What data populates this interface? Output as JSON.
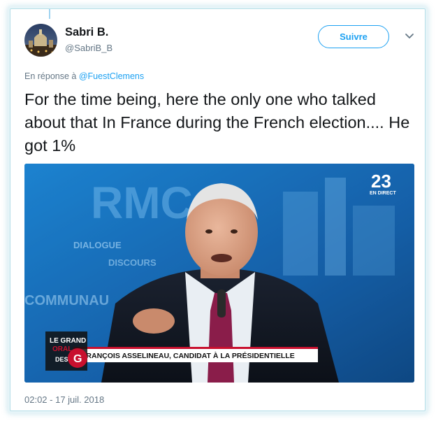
{
  "user": {
    "name": "Sabri B.",
    "handle": "@SabriB_B"
  },
  "follow_button": {
    "label": "Suivre"
  },
  "reply": {
    "prefix": "En réponse à",
    "mention": "@FuestClemens"
  },
  "tweet": {
    "text": "For the time being, here the only one who talked about that In France during the French election.... He got 1%"
  },
  "media": {
    "channel_logo": "23",
    "live_label": "EN DIRECT",
    "backdrop_text": "RMC",
    "backdrop_words": [
      "DIALOGUE",
      "DISCOURS",
      "COMMUNAU"
    ],
    "show_logo_lines": [
      "LE GRAND",
      "ORAL",
      "DES"
    ],
    "show_logo_letter": "G",
    "lower_third": "FRANÇOIS ASSELINEAU, CANDIDAT À LA PRÉSIDENTIELLE"
  },
  "timestamp": "02:02 - 17 juil. 2018",
  "colors": {
    "accent": "#1da1f2",
    "text": "#14171a",
    "muted": "#657786"
  },
  "icons": {
    "caret": "chevron-down-icon"
  }
}
